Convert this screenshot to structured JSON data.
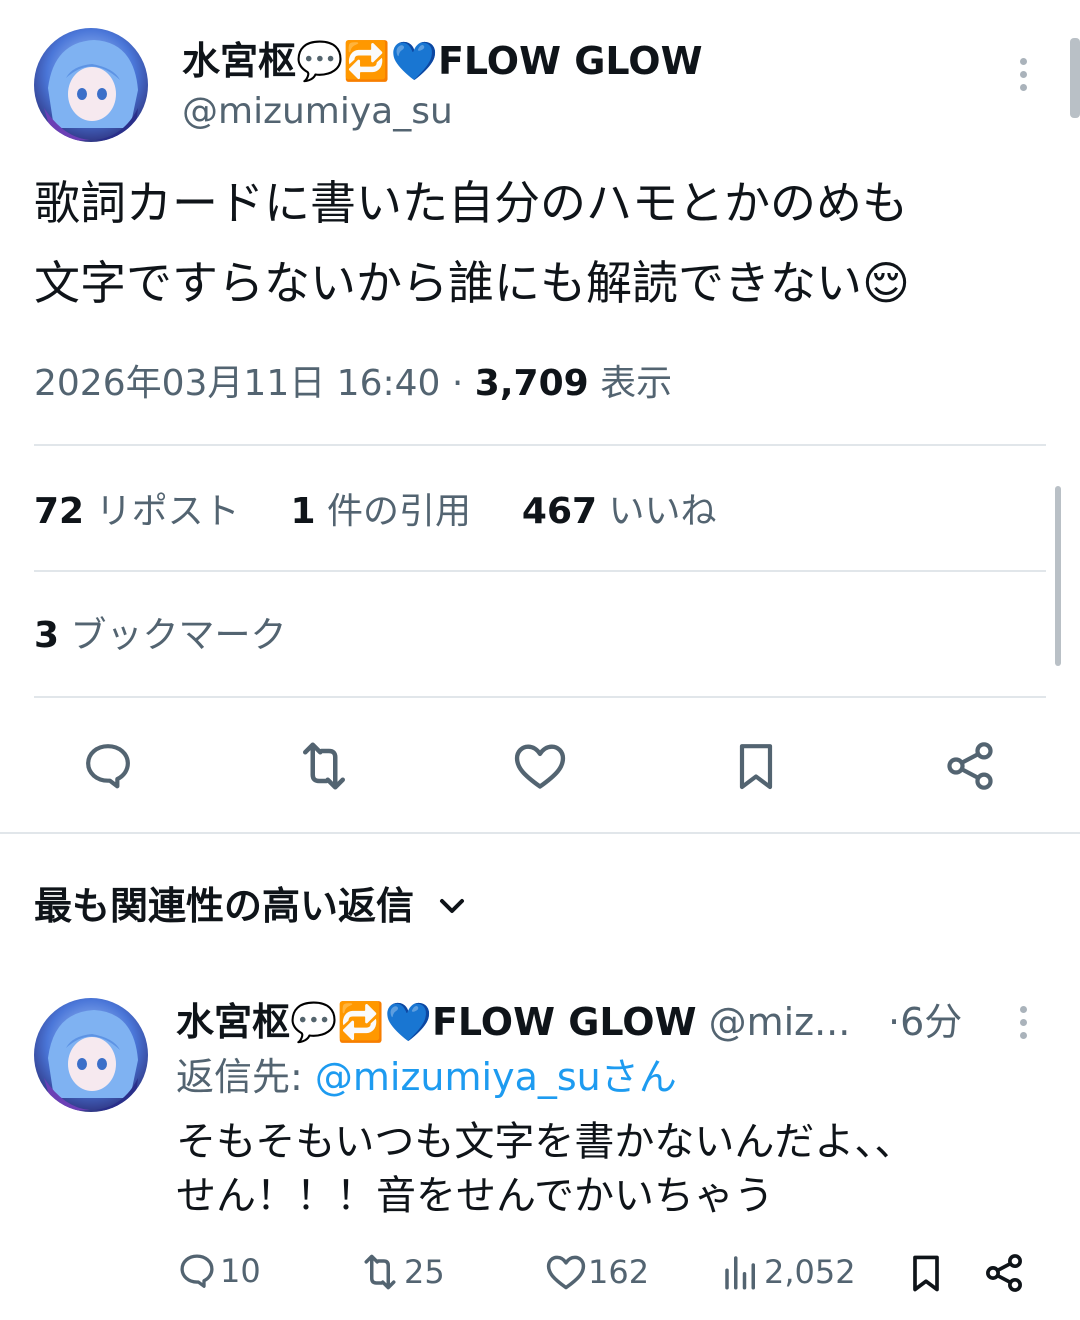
{
  "post": {
    "display_name": "水宮枢💬🔁💙FLOW GLOW",
    "handle": "@mizumiya_su",
    "text_line1": "歌詞カードに書いた自分のハモとかのめも",
    "text_line2": "文字ですらないから誰にも解読できない😌",
    "timestamp": "2026年03月11日 16:40",
    "separator": "·",
    "views_count": "3,709",
    "views_label": "表示",
    "stats": {
      "reposts_count": "72",
      "reposts_label": "リポスト",
      "quotes_count": "1",
      "quotes_label": "件の引用",
      "likes_count": "467",
      "likes_label": "いいね",
      "bookmarks_count": "3",
      "bookmarks_label": "ブックマーク"
    },
    "actions": [
      "reply-icon",
      "repost-icon",
      "like-icon",
      "bookmark-icon",
      "share-icon"
    ]
  },
  "replies_header": {
    "label": "最も関連性の高い返信"
  },
  "reply": {
    "display_name": "水宮枢💬🔁💙FLOW GLOW",
    "handle_truncated": "@miz...",
    "time": "·6分",
    "replying_to_label": "返信先:",
    "replying_to_handle": "@mizumiya_suさん",
    "text_line1": "そもそもいつも文字を書かないんだよ、、",
    "text_line2": "せん！！！音をせんでかいちゃう",
    "metrics": {
      "replies": "10",
      "reposts": "25",
      "likes": "162",
      "views": "2,052"
    }
  },
  "colors": {
    "text": "#0f1419",
    "muted": "#536471",
    "link": "#1d9bf0",
    "divider": "#e1e6ea"
  }
}
